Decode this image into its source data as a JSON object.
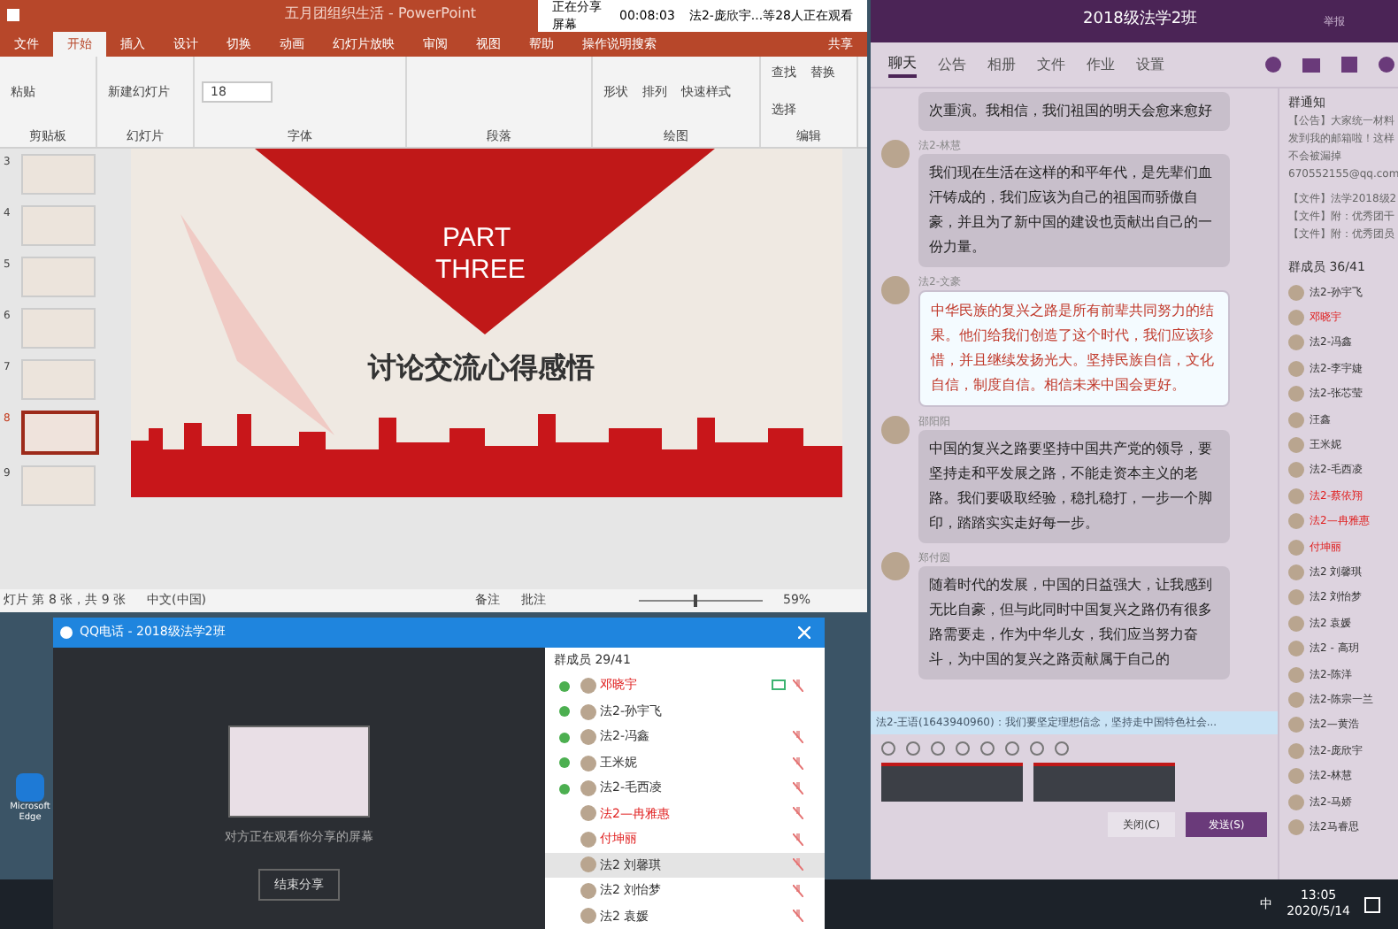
{
  "desktop": {
    "icons": [
      {
        "label": "Microsoft Edge"
      }
    ]
  },
  "powerpoint": {
    "title": "五月团组织生活 - PowerPoint",
    "share_bar": {
      "status": "正在分享屏幕",
      "time": "00:08:03",
      "viewers": "法2-庞欣宇...等28人正在观看"
    },
    "tabs": [
      {
        "label": "文件",
        "selected": false
      },
      {
        "label": "开始",
        "selected": true
      },
      {
        "label": "插入",
        "selected": false
      },
      {
        "label": "设计",
        "selected": false
      },
      {
        "label": "切换",
        "selected": false
      },
      {
        "label": "动画",
        "selected": false
      },
      {
        "label": "幻灯片放映",
        "selected": false
      },
      {
        "label": "审阅",
        "selected": false
      },
      {
        "label": "视图",
        "selected": false
      },
      {
        "label": "帮助",
        "selected": false
      }
    ],
    "search": "操作说明搜索",
    "share": "共享",
    "groups": [
      {
        "name": "剪贴板",
        "buttons": [
          "粘贴"
        ]
      },
      {
        "name": "幻灯片",
        "buttons": [
          "新建幻灯片"
        ]
      },
      {
        "name": "字体",
        "buttons": [
          "18"
        ]
      },
      {
        "name": "段落"
      },
      {
        "name": "绘图",
        "buttons": [
          "形状",
          "排列",
          "快速样式"
        ]
      },
      {
        "name": "编辑",
        "buttons": [
          "查找",
          "替换",
          "选择"
        ]
      }
    ],
    "thumbnails": [
      {
        "number": "3",
        "selected": false
      },
      {
        "number": "4",
        "selected": false
      },
      {
        "number": "5",
        "selected": false
      },
      {
        "number": "6",
        "selected": false
      },
      {
        "number": "7",
        "selected": false
      },
      {
        "number": "8",
        "selected": true
      },
      {
        "number": "9",
        "selected": false
      }
    ],
    "slide": {
      "part": "PART",
      "number": "THREE",
      "title": "讨论交流心得感悟"
    },
    "status": {
      "position": "灯片 第 8 张，共 9 张",
      "language": "中文(中国)",
      "notes": "备注",
      "comments": "批注",
      "zoom": "59%",
      "level": 0.45
    }
  },
  "call": {
    "title": "QQ电话 - 2018级法学2班",
    "caption": "对方正在观看你分享的屏幕",
    "end_button": "结束分享",
    "members_header": "群成员 29/41",
    "members": [
      {
        "name": "邓晓宇",
        "red": true,
        "speaker": true,
        "sharing": true,
        "muted": true,
        "selected": false
      },
      {
        "name": "法2-孙宇飞",
        "red": false,
        "speaker": true,
        "sharing": false,
        "muted": false,
        "selected": false
      },
      {
        "name": "法2-冯鑫",
        "red": false,
        "speaker": true,
        "sharing": false,
        "muted": true,
        "selected": false
      },
      {
        "name": "王米妮",
        "red": false,
        "speaker": true,
        "sharing": false,
        "muted": true,
        "selected": false
      },
      {
        "name": "法2-毛西凌",
        "red": false,
        "speaker": true,
        "sharing": false,
        "muted": true,
        "selected": false
      },
      {
        "name": "法2—冉雅惠",
        "red": true,
        "speaker": false,
        "sharing": false,
        "muted": true,
        "selected": false
      },
      {
        "name": "付坤丽",
        "red": true,
        "speaker": false,
        "sharing": false,
        "muted": true,
        "selected": false
      },
      {
        "name": "法2 刘馨琪",
        "red": false,
        "speaker": false,
        "sharing": false,
        "muted": true,
        "selected": true
      },
      {
        "name": "法2 刘怡梦",
        "red": false,
        "speaker": false,
        "sharing": false,
        "muted": true,
        "selected": false
      },
      {
        "name": "法2 袁媛",
        "red": false,
        "speaker": false,
        "sharing": false,
        "muted": true,
        "selected": false
      }
    ]
  },
  "chat": {
    "title": "2018级法学2班",
    "report": "举报",
    "tabs": [
      {
        "label": "聊天",
        "selected": true
      },
      {
        "label": "公告",
        "selected": false
      },
      {
        "label": "相册",
        "selected": false
      },
      {
        "label": "文件",
        "selected": false
      },
      {
        "label": "作业",
        "selected": false
      },
      {
        "label": "设置",
        "selected": false
      }
    ],
    "messages": [
      {
        "text": "次重演。我相信，我们祖国的明天会愈来愈好",
        "kind": "normal"
      },
      {
        "sender": "法2-林慧",
        "text": "我们现在生活在这样的和平年代，是先辈们血汗铸成的，我们应该为自己的祖国而骄傲自豪，并且为了新中国的建设也贡献出自己的一份力量。",
        "kind": "normal"
      },
      {
        "sender": "法2-文豪",
        "text": "中华民族的复兴之路是所有前辈共同努力的结果。他们给我们创造了这个时代，我们应该珍惜，并且继续发扬光大。坚持民族自信，文化自信，制度自信。相信未来中国会更好。",
        "kind": "highlight"
      },
      {
        "sender": "邵阳阳",
        "text": "中国的复兴之路要坚持中国共产党的领导，要坚持走和平发展之路，不能走资本主义的老路。我们要吸取经验，稳扎稳打，一步一个脚印，踏踏实实走好每一步。",
        "kind": "normal"
      },
      {
        "sender": "郑付圆",
        "text": "随着时代的发展，中国的日益强大，让我感到无比自豪，但与此同时中国复兴之路仍有很多路需要走，作为中华儿女，我们应当努力奋斗，为中国的复兴之路贡献属于自己的",
        "kind": "normal"
      }
    ],
    "mention": "法2-王语(1643940960)：我们要坚定理想信念，坚持走中国特色社会...",
    "close_button": "关闭(C)",
    "send_button": "发送(S)",
    "notice": {
      "title": "群通知",
      "lines": [
        "【公告】大家统一材料",
        "发到我的邮箱啦！这样",
        "不会被漏掉",
        "670552155@qq.com"
      ],
      "files": [
        "【文件】法学2018级2",
        "【文件】附：优秀团干",
        "【文件】附：优秀团员"
      ]
    },
    "members_header": "群成员 36/41",
    "members": [
      {
        "name": "法2-孙宇飞",
        "red": false
      },
      {
        "name": "邓晓宇",
        "red": true
      },
      {
        "name": "法2-冯鑫",
        "red": false
      },
      {
        "name": "法2-李宇婕",
        "red": false
      },
      {
        "name": "法2-张芯莹",
        "red": false
      },
      {
        "name": "汪鑫",
        "red": false
      },
      {
        "name": "王米妮",
        "red": false
      },
      {
        "name": "法2-毛西凌",
        "red": false
      },
      {
        "name": "法2-蔡依翔",
        "red": true
      },
      {
        "name": "法2—冉雅惠",
        "red": true
      },
      {
        "name": "付坤丽",
        "red": true
      },
      {
        "name": "法2 刘馨琪",
        "red": false
      },
      {
        "name": "法2 刘怡梦",
        "red": false
      },
      {
        "name": "法2 袁媛",
        "red": false
      },
      {
        "name": "法2 - 高玥",
        "red": false
      },
      {
        "name": "法2-陈洋",
        "red": false
      },
      {
        "name": "法2-陈宗一兰",
        "red": false
      },
      {
        "name": "法2—黄浩",
        "red": false
      },
      {
        "name": "法2-庞欣宇",
        "red": false
      },
      {
        "name": "法2-林慧",
        "red": false
      },
      {
        "name": "法2-马娇",
        "red": false
      },
      {
        "name": "法2马睿思",
        "red": false
      }
    ]
  },
  "taskbar": {
    "ime": "中",
    "time": "13:05",
    "date": "2020/5/14"
  }
}
